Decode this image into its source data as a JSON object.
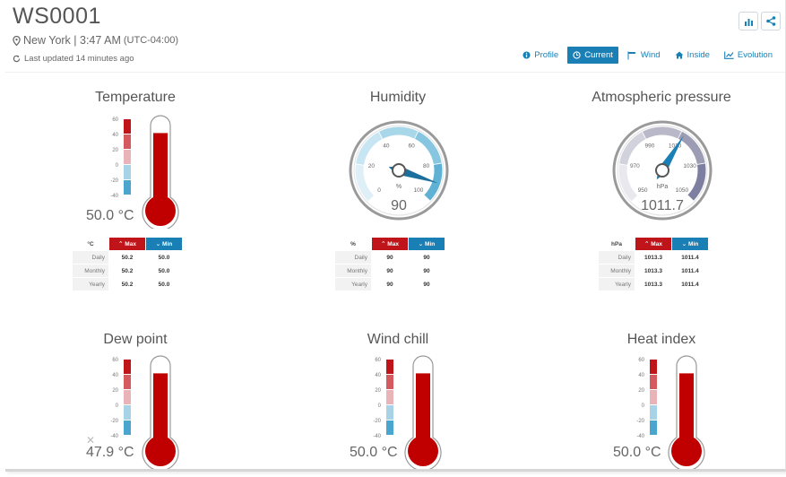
{
  "station": {
    "name": "WS0001",
    "location": "New York | 3:47 AM",
    "timezone": "(UTC-04:00)",
    "last_updated": "Last updated 14 minutes ago"
  },
  "nav": {
    "profile": "Profile",
    "current": "Current",
    "wind": "Wind",
    "inside": "Inside",
    "evolution": "Evolution"
  },
  "colors": {
    "accent": "#1a7fb5",
    "max": "#c0141b",
    "mercury": "#c00000"
  },
  "thermo_scale": [
    "60",
    "40",
    "20",
    "0",
    "-20",
    "-40"
  ],
  "temperature": {
    "title": "Temperature",
    "value": "50.0 °C",
    "level": 0.9,
    "table": {
      "unit": "°C",
      "max": "Max",
      "min": "Min",
      "rows": [
        {
          "label": "Daily",
          "max": "50.2",
          "min": "50.0"
        },
        {
          "label": "Monthly",
          "max": "50.2",
          "min": "50.0"
        },
        {
          "label": "Yearly",
          "max": "50.2",
          "min": "50.0"
        }
      ]
    }
  },
  "humidity": {
    "title": "Humidity",
    "value": "90",
    "unit_label": "%",
    "ticks": [
      "0",
      "20",
      "40",
      "60",
      "80",
      "100"
    ],
    "reading": 90,
    "table": {
      "unit": "%",
      "max": "Max",
      "min": "Min",
      "rows": [
        {
          "label": "Daily",
          "max": "90",
          "min": "90"
        },
        {
          "label": "Monthly",
          "max": "90",
          "min": "90"
        },
        {
          "label": "Yearly",
          "max": "90",
          "min": "90"
        }
      ]
    }
  },
  "pressure": {
    "title": "Atmospheric pressure",
    "value": "1011.7",
    "unit_label": "hPa",
    "ticks": [
      "950",
      "970",
      "990",
      "1010",
      "1030",
      "1050"
    ],
    "reading": 1011.7,
    "table": {
      "unit": "hPa",
      "max": "Max",
      "min": "Min",
      "rows": [
        {
          "label": "Daily",
          "max": "1013.3",
          "min": "1011.4"
        },
        {
          "label": "Monthly",
          "max": "1013.3",
          "min": "1011.4"
        },
        {
          "label": "Yearly",
          "max": "1013.3",
          "min": "1011.4"
        }
      ]
    }
  },
  "dew_point": {
    "title": "Dew point",
    "value": "47.9 °C",
    "level": 0.9
  },
  "wind_chill": {
    "title": "Wind chill",
    "value": "50.0 °C",
    "level": 0.9
  },
  "heat_index": {
    "title": "Heat index",
    "value": "50.0 °C",
    "level": 0.9
  }
}
